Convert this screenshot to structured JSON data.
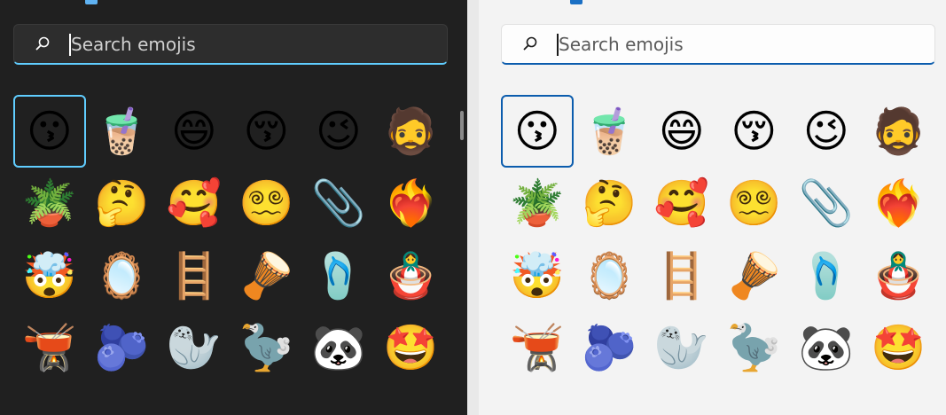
{
  "search": {
    "placeholder": "Search emojis",
    "value": ""
  },
  "colors": {
    "dark_accent": "#60cdff",
    "light_accent": "#0b5cad"
  },
  "emojis": [
    {
      "glyph": "😗",
      "name": "kissing-face"
    },
    {
      "glyph": "🧋",
      "name": "bubble-tea"
    },
    {
      "glyph": "😄",
      "name": "grinning-face"
    },
    {
      "glyph": "😚",
      "name": "kissing-face-closed-eyes"
    },
    {
      "glyph": "😉",
      "name": "winking-face"
    },
    {
      "glyph": "🧔",
      "name": "person-beard"
    },
    {
      "glyph": "🪴",
      "name": "potted-plant"
    },
    {
      "glyph": "🤔",
      "name": "thinking-face"
    },
    {
      "glyph": "🥰",
      "name": "smiling-face-hearts"
    },
    {
      "glyph": "😵‍💫",
      "name": "face-spiral-eyes"
    },
    {
      "glyph": "📎",
      "name": "paperclip"
    },
    {
      "glyph": "❤️‍🔥",
      "name": "heart-on-fire"
    },
    {
      "glyph": "🤯",
      "name": "exploding-head"
    },
    {
      "glyph": "🪞",
      "name": "mirror"
    },
    {
      "glyph": "🪜",
      "name": "ladder"
    },
    {
      "glyph": "🪘",
      "name": "long-drum"
    },
    {
      "glyph": "🩴",
      "name": "thong-sandal"
    },
    {
      "glyph": "🪆",
      "name": "nesting-dolls"
    },
    {
      "glyph": "🫕",
      "name": "fondue"
    },
    {
      "glyph": "🫐",
      "name": "blueberries"
    },
    {
      "glyph": "🦭",
      "name": "seal"
    },
    {
      "glyph": "🦤",
      "name": "dodo"
    },
    {
      "glyph": "🐼",
      "name": "panda"
    },
    {
      "glyph": "🤩",
      "name": "star-struck"
    }
  ],
  "selected_index": 0
}
